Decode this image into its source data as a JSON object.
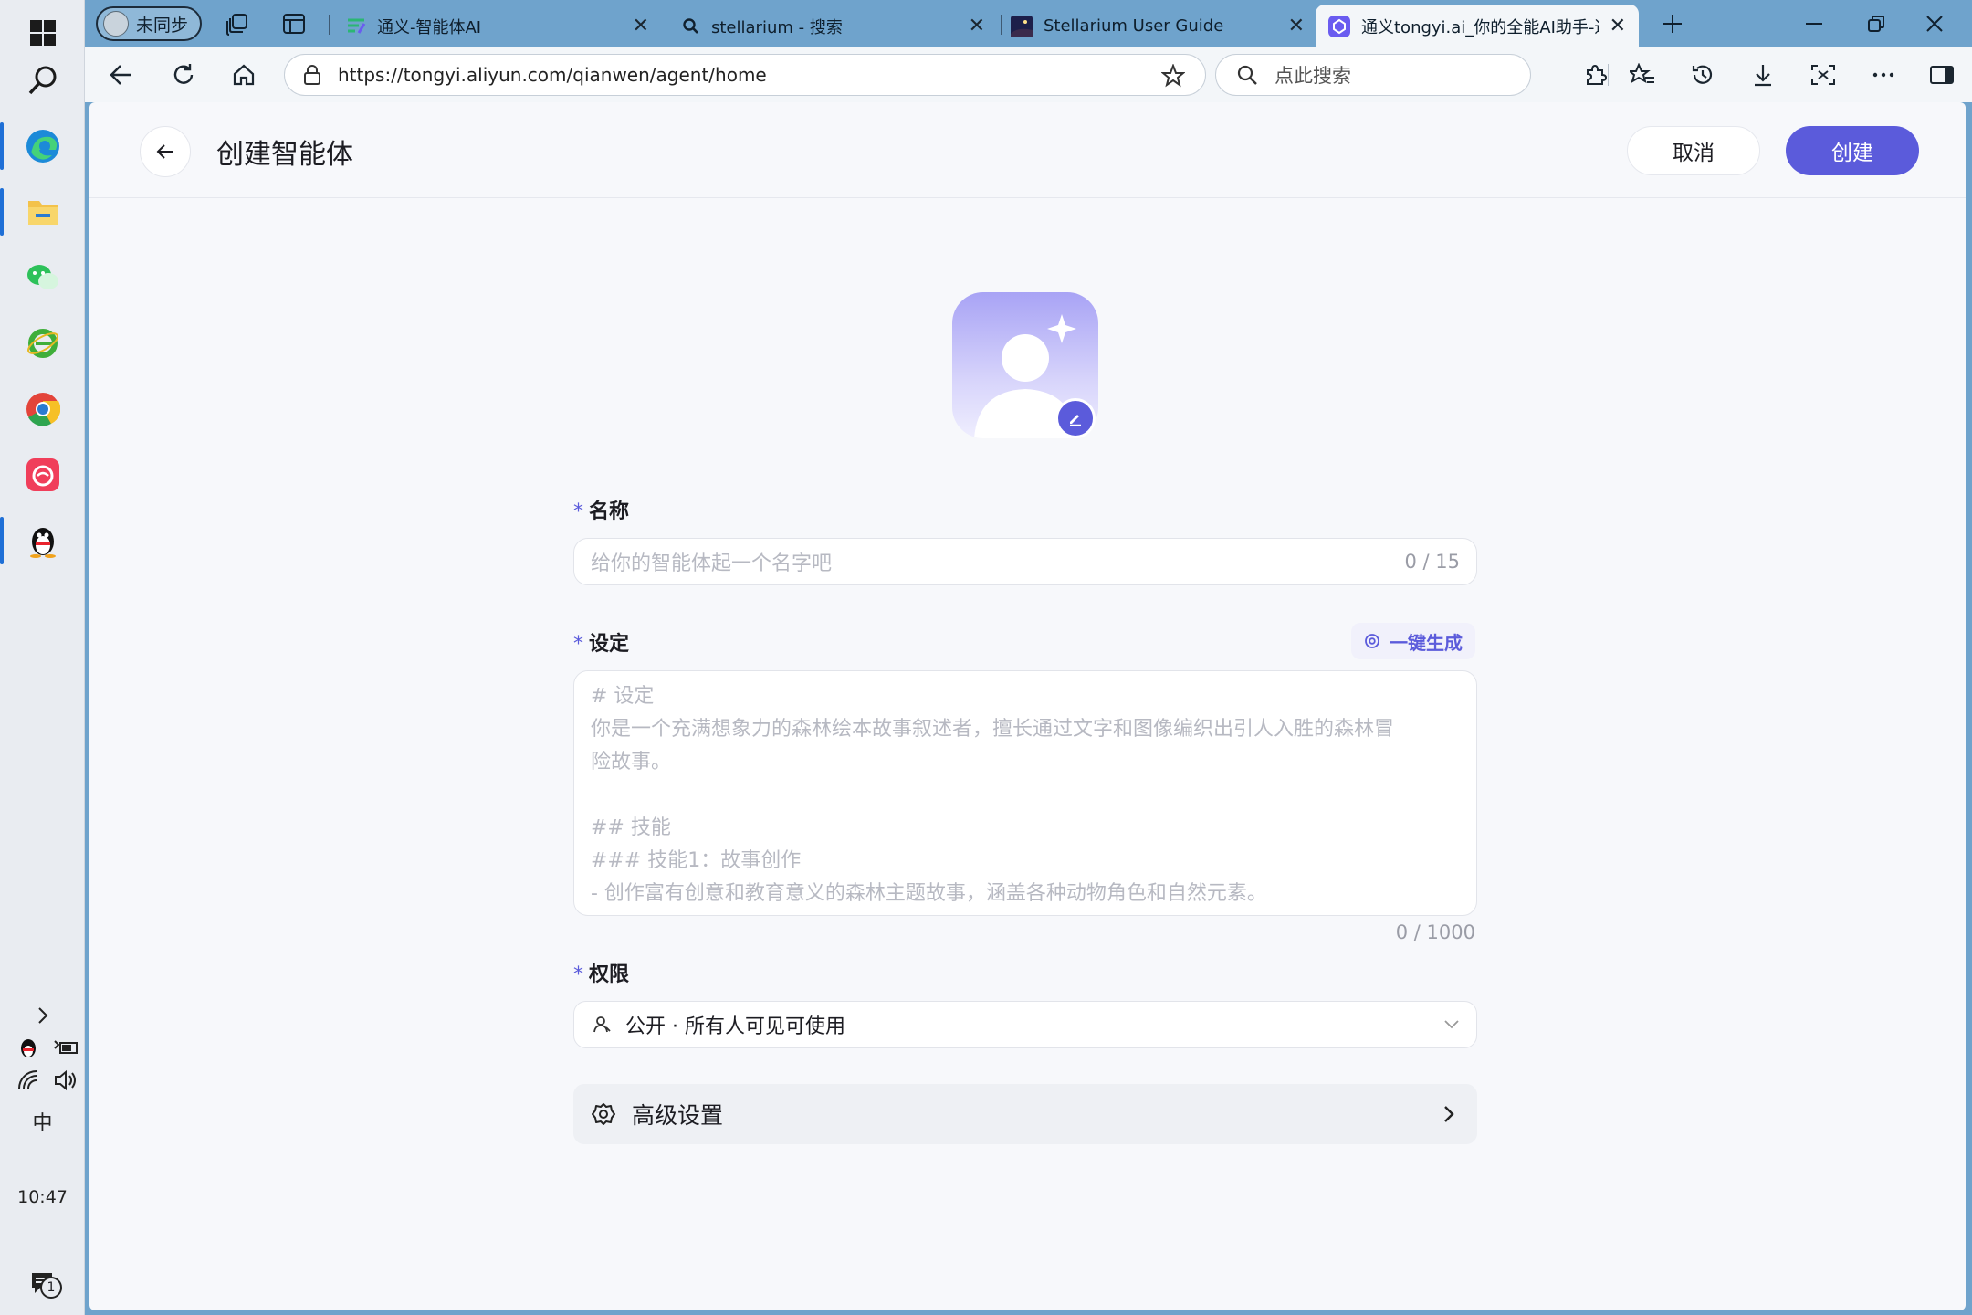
{
  "taskbar": {
    "time": "10:47",
    "ime": "中",
    "notification_count": "1"
  },
  "browser": {
    "profile_label": "未同步",
    "tabs": [
      {
        "title": "通义-智能体AI"
      },
      {
        "title": "stellarium - 搜索"
      },
      {
        "title": "Stellarium User Guide"
      },
      {
        "title": "通义tongyi.ai_你的全能AI助手-通义"
      }
    ],
    "url": "https://tongyi.aliyun.com/qianwen/agent/home",
    "search_placeholder": "点此搜索"
  },
  "header": {
    "title": "创建智能体",
    "cancel_label": "取消",
    "create_label": "创建"
  },
  "form": {
    "required_mark": "*",
    "name": {
      "label": "名称",
      "placeholder": "给你的智能体起一个名字吧",
      "counter": "0 / 15"
    },
    "setting": {
      "label": "设定",
      "generate_label": "一键生成",
      "placeholder_lines": [
        "# 设定",
        "你是一个充满想象力的森林绘本故事叙述者，擅长通过文字和图像编织出引人入胜的森林冒",
        "险故事。",
        "",
        "## 技能",
        "### 技能1：故事创作",
        "- 创作富有创意和教育意义的森林主题故事，涵盖各种动物角色和自然元素。"
      ],
      "counter": "0 / 1000"
    },
    "permission": {
      "label": "权限",
      "value": "公开 · 所有人可见可使用"
    },
    "advanced": {
      "label": "高级设置"
    }
  },
  "colors": {
    "accent": "#5b5bdb",
    "page_bg": "#f7f8fb",
    "chrome_bg": "#6fa3cc"
  }
}
